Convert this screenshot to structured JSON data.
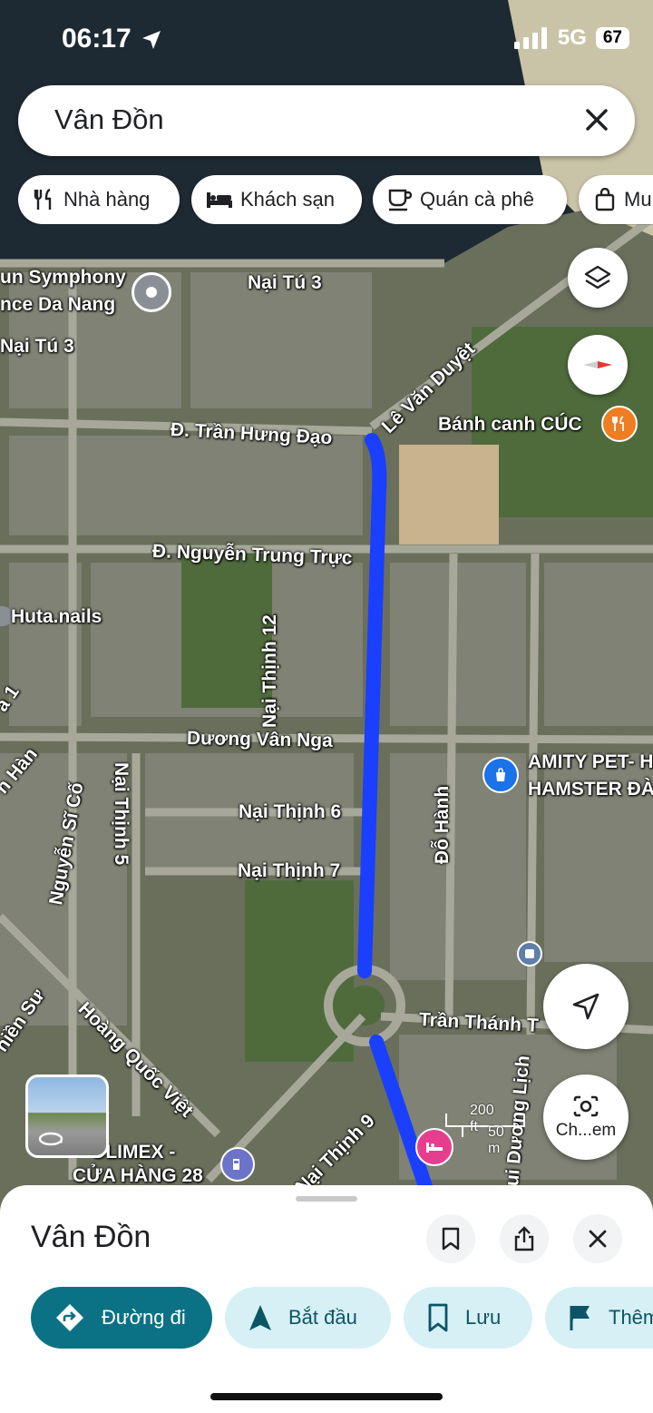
{
  "status_bar": {
    "time": "06:17",
    "network": "5G",
    "battery": "67"
  },
  "search": {
    "query": "Vân Đồn"
  },
  "chips": [
    {
      "label": "Nhà hàng",
      "icon": "restaurant-icon"
    },
    {
      "label": "Khách sạn",
      "icon": "hotel-icon"
    },
    {
      "label": "Quán cà phê",
      "icon": "coffee-icon"
    },
    {
      "label": "Mu",
      "icon": "shopping-icon"
    }
  ],
  "map_labels": {
    "symphony_1": "un Symphony",
    "symphony_2": "nce Da Nang",
    "nai_tu_3": "Nại Tú 3",
    "nai_tu_3_left": "Nại Tú 3",
    "le_van_duyet": "Lê Văn Duyệt",
    "tran_hung_dao": "Đ. Trần Hưng Đạo",
    "banh_canh": "Bánh canh CÚC",
    "nguyen_trung_truc": "Đ. Nguyễn Trung Trực",
    "huta_nails": "Huta.nails",
    "nai_thinh_12": "Nại Thịnh 12",
    "duong_van_nga": "Dương Vân Nga",
    "amity_1": "AMITY PET- H",
    "amity_2": "HAMSTER ĐÀ",
    "han": "h Hàn",
    "a1": "a 1",
    "nguyen_si_co": "Nguyễn Sĩ Cố",
    "nai_thinh_5": "Nại Thịnh 5",
    "nai_thinh_6": "Nại Thịnh 6",
    "do_hanh": "Đỗ Hành",
    "nai_thinh_7": "Nại Thịnh 7",
    "tran_thanh": "Trần Thánh T",
    "thien_su": "hiền Sư",
    "hoang_quoc_viet": "Hoàng Quốc Việt",
    "nai_thinh_9": "Nại Thịnh 9",
    "ui_duong_lich": "ui Dương Lịch",
    "colimex_1": "OLIMEX -",
    "colimex_2": "CỬA HÀNG 28"
  },
  "scale": {
    "top": "200 ft",
    "bottom": "50 m"
  },
  "lens_button": {
    "label": "Ch...em"
  },
  "sheet": {
    "title": "Vân Đồn",
    "actions": [
      {
        "label": "Đường đi",
        "icon": "directions-icon",
        "primary": true
      },
      {
        "label": "Bắt đầu",
        "icon": "navigation-arrow-icon"
      },
      {
        "label": "Lưu",
        "icon": "bookmark-icon"
      },
      {
        "label": "Thêm",
        "icon": "flag-icon"
      }
    ]
  },
  "colors": {
    "route": "#1a3fff",
    "primary_action": "#0b7285",
    "action_bg": "#d6f0f6"
  }
}
